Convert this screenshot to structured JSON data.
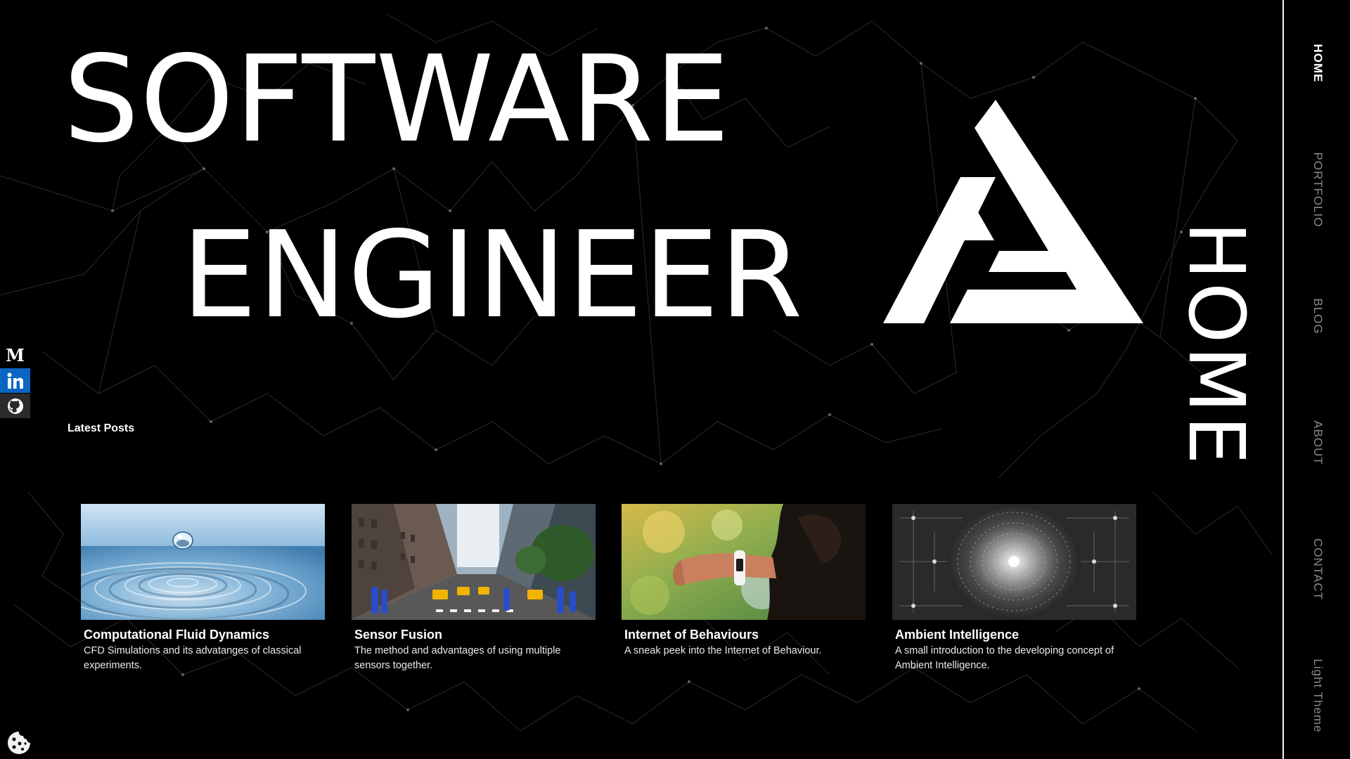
{
  "hero": {
    "line1": "SOFTWARE",
    "line2": "ENGINEER",
    "logo_icon": "triangle-a-logo"
  },
  "page_title": "HOME",
  "nav": {
    "items": [
      {
        "label": "HOME",
        "active": true
      },
      {
        "label": "PORTFOLIO",
        "active": false
      },
      {
        "label": "BLOG",
        "active": false
      },
      {
        "label": "ABOUT",
        "active": false
      },
      {
        "label": "CONTACT",
        "active": false
      },
      {
        "label": "Light Theme",
        "active": false
      }
    ]
  },
  "social": {
    "medium_glyph": "M",
    "icons": [
      "medium-icon",
      "linkedin-icon",
      "github-icon"
    ]
  },
  "latest_posts": {
    "heading": "Latest Posts",
    "posts": [
      {
        "title": "Computational Fluid Dynamics",
        "description": "CFD Simulations and its advatanges of classical experiments.",
        "image": "water-drop-image"
      },
      {
        "title": "Sensor Fusion",
        "description": "The method and advantages of using multiple sensors together.",
        "image": "city-street-image"
      },
      {
        "title": "Internet of Behaviours",
        "description": "A sneak peek into the Internet of Behaviour.",
        "image": "smartwatch-image"
      },
      {
        "title": "Ambient Intelligence",
        "description": "A small introduction to the developing concept of Ambient Intelligence.",
        "image": "binary-tunnel-image"
      }
    ]
  },
  "colors": {
    "background": "#000000",
    "text": "#ffffff",
    "nav_inactive": "#8a8a8a",
    "linkedin": "#0a66c2",
    "github": "#2b2b2b"
  },
  "cookie_icon": "cookie-icon"
}
